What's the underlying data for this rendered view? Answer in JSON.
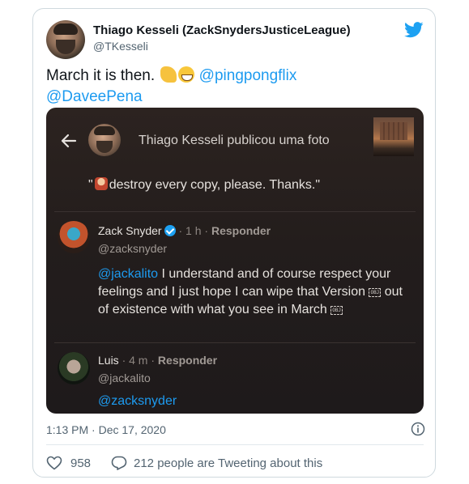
{
  "tweet": {
    "author_name": "Thiago Kesseli (ZackSnydersJusticeLeague)",
    "author_handle": "@TKesseli",
    "text_before": "March it is then.",
    "mention_1": "@pingpongflix",
    "mention_2": "@DaveePena",
    "timestamp": "1:13 PM · Dec 17, 2020",
    "likes": "958",
    "people_tweeting": "212 people are Tweeting about this"
  },
  "embedded": {
    "title": "Thiago Kesseli publicou uma foto",
    "caption_open": "\"",
    "caption": "destroy every copy, please. Thanks.\"",
    "reply1": {
      "name": "Zack Snyder",
      "time": "· 1 h ·",
      "action": "Responder",
      "handle": "@zacksnyder",
      "mention": "@jackalito",
      "text_a": "I understand and of course respect your feelings and I just hope I can wipe that Version",
      "text_b": "out of existence with what you see in March",
      "obj_label": "OBJ"
    },
    "reply2": {
      "name": "Luis",
      "time": "· 4 m ·",
      "action": "Responder",
      "handle": "@jackalito",
      "text": "@zacksnyder"
    }
  },
  "colors": {
    "accent": "#1d9bf0",
    "twitter_blue": "#1da1f2",
    "muted": "#536471"
  },
  "icons": [
    "twitter-bird-icon",
    "back-arrow-icon",
    "verified-icon",
    "info-icon",
    "heart-icon",
    "reply-icon"
  ]
}
